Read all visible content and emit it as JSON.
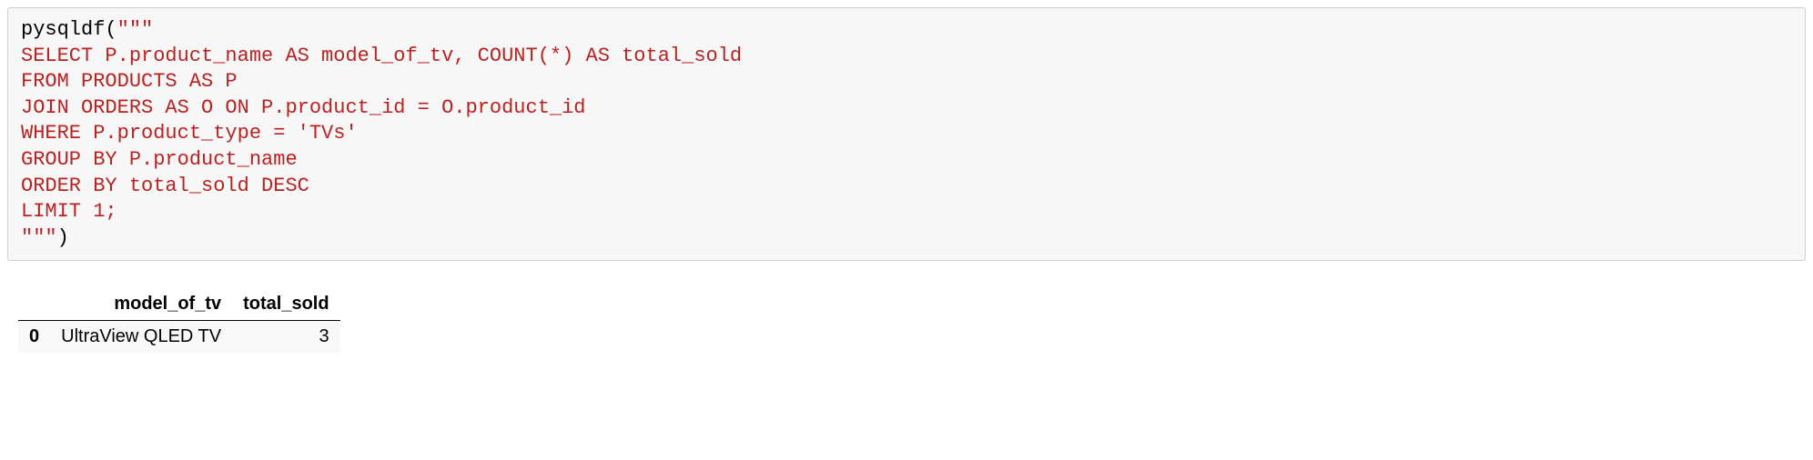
{
  "code": {
    "call_open": "pysqldf(",
    "triple_open": "\"\"\"",
    "line1": "SELECT P.product_name AS model_of_tv, COUNT(*) AS total_sold",
    "line2": "FROM PRODUCTS AS P",
    "line3": "JOIN ORDERS AS O ON P.product_id = O.product_id",
    "line4": "WHERE P.product_type = 'TVs'",
    "line5": "GROUP BY P.product_name",
    "line6": "ORDER BY total_sold DESC",
    "line7": "LIMIT 1;",
    "triple_close": "\"\"\"",
    "call_close": ")"
  },
  "table": {
    "headers": {
      "index": "",
      "col1": "model_of_tv",
      "col2": "total_sold"
    },
    "rows": [
      {
        "index": "0",
        "model_of_tv": "UltraView QLED TV",
        "total_sold": "3"
      }
    ]
  }
}
